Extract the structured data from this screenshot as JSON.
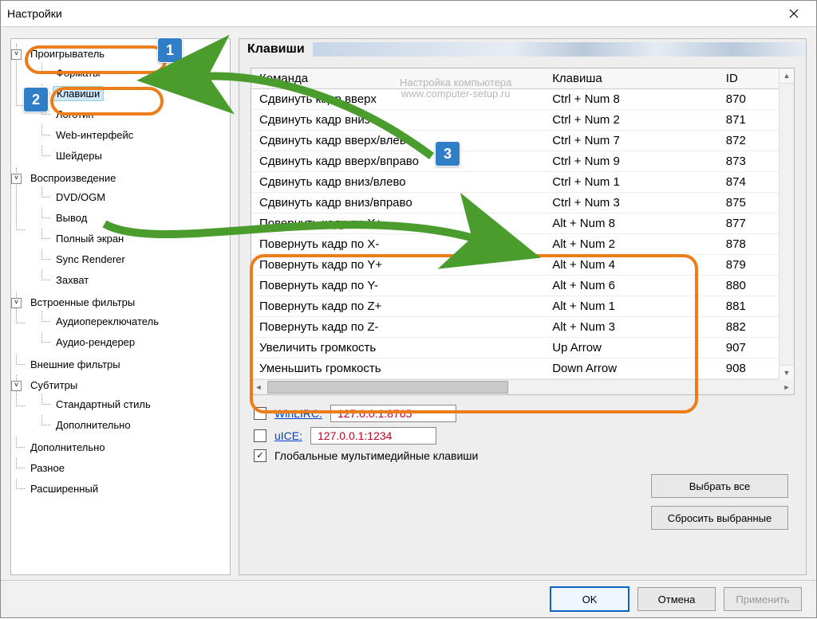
{
  "window": {
    "title": "Настройки"
  },
  "tree": [
    {
      "label": "Проигрыватель",
      "expanded": true,
      "children": [
        {
          "label": "Форматы"
        },
        {
          "label": "Клавиши",
          "selected": true
        },
        {
          "label": "Логотип"
        },
        {
          "label": "Web-интерфейс"
        },
        {
          "label": "Шейдеры"
        }
      ]
    },
    {
      "label": "Воспроизведение",
      "expanded": true,
      "children": [
        {
          "label": "DVD/OGM"
        },
        {
          "label": "Вывод"
        },
        {
          "label": "Полный экран"
        },
        {
          "label": "Sync Renderer"
        },
        {
          "label": "Захват"
        }
      ]
    },
    {
      "label": "Встроенные фильтры",
      "expanded": true,
      "children": [
        {
          "label": "Аудиопереключатель"
        },
        {
          "label": "Аудио-рендерер"
        }
      ]
    },
    {
      "label": "Внешние фильтры"
    },
    {
      "label": "Субтитры",
      "expanded": true,
      "children": [
        {
          "label": "Стандартный стиль"
        },
        {
          "label": "Дополнительно"
        }
      ]
    },
    {
      "label": "Дополнительно"
    },
    {
      "label": "Разное"
    },
    {
      "label": "Расширенный"
    }
  ],
  "section": {
    "title": "Клавиши"
  },
  "columns": {
    "command": "Команда",
    "key": "Клавиша",
    "id": "ID"
  },
  "rows": [
    {
      "cmd": "Команда",
      "key": "Клавиша",
      "id": "ID",
      "header": true
    },
    {
      "cmd": "Сдвинуть кадр вверх",
      "key": "Ctrl + Num 8",
      "id": "870"
    },
    {
      "cmd": "Сдвинуть кадр вниз",
      "key": "Ctrl + Num 2",
      "id": "871"
    },
    {
      "cmd": "Сдвинуть кадр вверх/влево",
      "key": "Ctrl + Num 7",
      "id": "872"
    },
    {
      "cmd": "Сдвинуть кадр вверх/вправо",
      "key": "Ctrl + Num 9",
      "id": "873"
    },
    {
      "cmd": "Сдвинуть кадр вниз/влево",
      "key": "Ctrl + Num 1",
      "id": "874"
    },
    {
      "cmd": "Сдвинуть кадр вниз/вправо",
      "key": "Ctrl + Num 3",
      "id": "875"
    },
    {
      "cmd": "Повернуть кадр по X+",
      "key": "Alt + Num 8",
      "id": "877"
    },
    {
      "cmd": "Повернуть кадр по X-",
      "key": "Alt + Num 2",
      "id": "878"
    },
    {
      "cmd": "Повернуть кадр по Y+",
      "key": "Alt + Num 4",
      "id": "879"
    },
    {
      "cmd": "Повернуть кадр по Y-",
      "key": "Alt + Num 6",
      "id": "880"
    },
    {
      "cmd": "Повернуть кадр по Z+",
      "key": "Alt + Num 1",
      "id": "881"
    },
    {
      "cmd": "Повернуть кадр по Z-",
      "key": "Alt + Num 3",
      "id": "882"
    },
    {
      "cmd": "Увеличить громкость",
      "key": "Up Arrow",
      "id": "907"
    },
    {
      "cmd": "Уменьшить громкость",
      "key": "Down Arrow",
      "id": "908"
    }
  ],
  "options": {
    "winlirc_label": "WinLIRC:",
    "winlirc_value": "127.0.0.1:8765",
    "winlirc_checked": false,
    "uice_label": "uICE:",
    "uice_value": "127.0.0.1:1234",
    "uice_checked": false,
    "global_label": "Глобальные мультимедийные клавиши",
    "global_checked": true
  },
  "buttons": {
    "select_all": "Выбрать все",
    "reset_selected": "Сбросить выбранные",
    "ok": "OK",
    "cancel": "Отмена",
    "apply": "Применить"
  },
  "watermark": {
    "line1": "Настройка компьютера",
    "line2": "www.computer-setup.ru"
  },
  "annotations": {
    "b1": "1",
    "b2": "2",
    "b3": "3"
  }
}
